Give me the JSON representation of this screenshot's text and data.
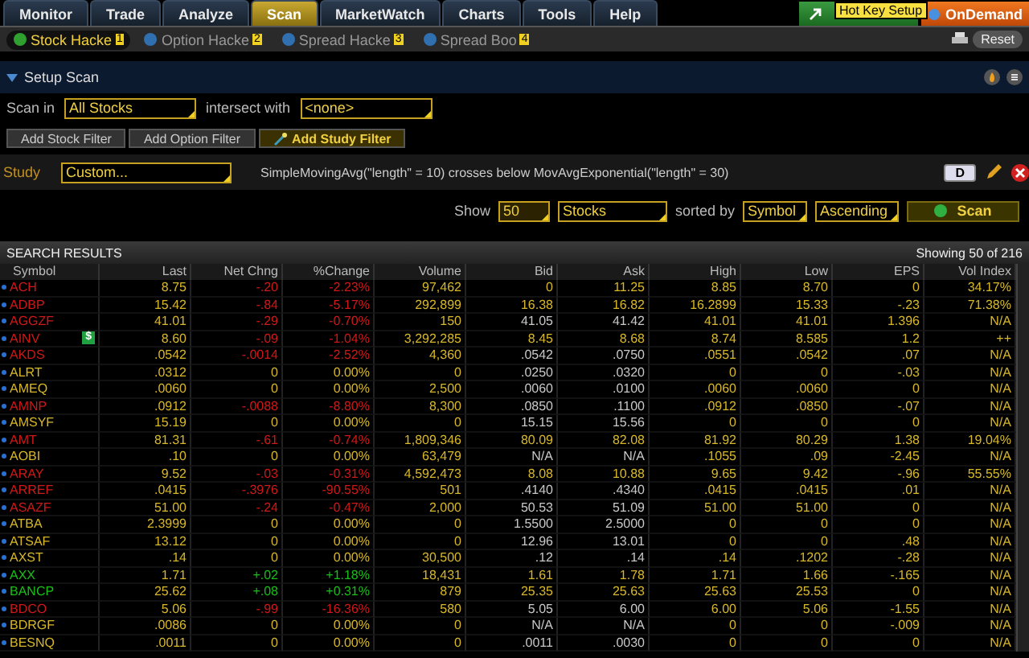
{
  "tabs": [
    {
      "label": "Monitor",
      "selected": false
    },
    {
      "label": "Trade",
      "selected": false
    },
    {
      "label": "Analyze",
      "selected": false
    },
    {
      "label": "Scan",
      "selected": true
    },
    {
      "label": "MarketWatch",
      "selected": false
    },
    {
      "label": "Charts",
      "selected": false
    },
    {
      "label": "Tools",
      "selected": false
    },
    {
      "label": "Help",
      "selected": false
    }
  ],
  "top_right": {
    "tooltip": "Hot Key Setup",
    "ondemand": "OnDemand"
  },
  "subtabs": [
    {
      "label": "Stock Hacke",
      "number": "1",
      "selected": true
    },
    {
      "label": "Option Hacke",
      "number": "2",
      "selected": false
    },
    {
      "label": "Spread Hacke",
      "number": "3",
      "selected": false
    },
    {
      "label": "Spread Boo",
      "number": "4",
      "selected": false
    }
  ],
  "reset_button": "Reset",
  "setup": {
    "title": "Setup Scan",
    "expanded": true,
    "scan_in_label": "Scan in",
    "scan_in": "All Stocks",
    "intersect_label": "intersect with",
    "intersect": "<none>"
  },
  "filter_buttons": [
    "Add Stock Filter",
    "Add Option Filter",
    "Add Study Filter"
  ],
  "study": {
    "label": "Study",
    "value": "Custom...",
    "formula": "SimpleMovingAvg(\"length\" = 10) crosses below MovAvgExponential(\"length\" = 30)",
    "button": "D"
  },
  "show_row": {
    "show_label": "Show",
    "count": "50",
    "type": "Stocks",
    "sorted_label": "sorted by",
    "sort_field": "Symbol",
    "order": "Ascending",
    "scan_button": "Scan"
  },
  "results": {
    "title": "SEARCH RESULTS",
    "showing": "Showing 50 of 216",
    "columns": [
      "Symbol",
      "Last",
      "Net Chng",
      "%Change",
      "Volume",
      "Bid",
      "Ask",
      "High",
      "Low",
      "EPS",
      "Vol Index"
    ],
    "rows": [
      {
        "symbol": "ACH",
        "last": "8.75",
        "net_chng": "-.20",
        "pct_change": "-2.23%",
        "volume": "97,462",
        "bid": "0",
        "ask": "11.25",
        "high": "8.85",
        "low": "8.70",
        "eps": "0",
        "vol_index": "34.17%",
        "color": "#d01818",
        "stale": false
      },
      {
        "symbol": "ADBP",
        "last": "15.42",
        "net_chng": "-.84",
        "pct_change": "-5.17%",
        "volume": "292,899",
        "bid": "16.38",
        "ask": "16.82",
        "high": "16.2899",
        "low": "15.33",
        "eps": "-.23",
        "vol_index": "71.38%",
        "color": "#d01818",
        "stale": false
      },
      {
        "symbol": "AGGZF",
        "last": "41.01",
        "net_chng": "-.29",
        "pct_change": "-0.70%",
        "volume": "150",
        "bid": "41.05",
        "ask": "41.42",
        "high": "41.01",
        "low": "41.01",
        "eps": "1.396",
        "vol_index": "N/A",
        "color": "#d01818",
        "stale": true
      },
      {
        "symbol": "AINV",
        "badge": "$",
        "last": "8.60",
        "net_chng": "-.09",
        "pct_change": "-1.04%",
        "volume": "3,292,285",
        "bid": "8.45",
        "ask": "8.68",
        "high": "8.74",
        "low": "8.585",
        "eps": "1.2",
        "vol_index": "++",
        "color": "#d01818",
        "stale": false
      },
      {
        "symbol": "AKDS",
        "last": ".0542",
        "net_chng": "-.0014",
        "pct_change": "-2.52%",
        "volume": "4,360",
        "bid": ".0542",
        "ask": ".0750",
        "high": ".0551",
        "low": ".0542",
        "eps": ".07",
        "vol_index": "N/A",
        "color": "#d01818",
        "stale": true
      },
      {
        "symbol": "ALRT",
        "last": ".0312",
        "net_chng": "0",
        "pct_change": "0.00%",
        "volume": "0",
        "bid": ".0250",
        "ask": ".0320",
        "high": "0",
        "low": "0",
        "eps": "-.03",
        "vol_index": "N/A",
        "color": "#d8b828",
        "stale": true
      },
      {
        "symbol": "AMEQ",
        "last": ".0060",
        "net_chng": "0",
        "pct_change": "0.00%",
        "volume": "2,500",
        "bid": ".0060",
        "ask": ".0100",
        "high": ".0060",
        "low": ".0060",
        "eps": "0",
        "vol_index": "N/A",
        "color": "#d8b828",
        "stale": true
      },
      {
        "symbol": "AMNP",
        "last": ".0912",
        "net_chng": "-.0088",
        "pct_change": "-8.80%",
        "volume": "8,300",
        "bid": ".0850",
        "ask": ".1100",
        "high": ".0912",
        "low": ".0850",
        "eps": "-.07",
        "vol_index": "N/A",
        "color": "#d01818",
        "stale": true
      },
      {
        "symbol": "AMSYF",
        "last": "15.19",
        "net_chng": "0",
        "pct_change": "0.00%",
        "volume": "0",
        "bid": "15.15",
        "ask": "15.56",
        "high": "0",
        "low": "0",
        "eps": "0",
        "vol_index": "N/A",
        "color": "#d8b828",
        "stale": true
      },
      {
        "symbol": "AMT",
        "last": "81.31",
        "net_chng": "-.61",
        "pct_change": "-0.74%",
        "volume": "1,809,346",
        "bid": "80.09",
        "ask": "82.08",
        "high": "81.92",
        "low": "80.29",
        "eps": "1.38",
        "vol_index": "19.04%",
        "color": "#d01818",
        "stale": false
      },
      {
        "symbol": "AOBI",
        "last": ".10",
        "net_chng": "0",
        "pct_change": "0.00%",
        "volume": "63,479",
        "bid": "N/A",
        "ask": "N/A",
        "high": ".1055",
        "low": ".09",
        "eps": "-2.45",
        "vol_index": "N/A",
        "color": "#d8b828",
        "stale": true
      },
      {
        "symbol": "ARAY",
        "last": "9.52",
        "net_chng": "-.03",
        "pct_change": "-0.31%",
        "volume": "4,592,473",
        "bid": "8.08",
        "ask": "10.88",
        "high": "9.65",
        "low": "9.42",
        "eps": "-.96",
        "vol_index": "55.55%",
        "color": "#d01818",
        "stale": false
      },
      {
        "symbol": "ARREF",
        "last": ".0415",
        "net_chng": "-.3976",
        "pct_change": "-90.55%",
        "volume": "501",
        "bid": ".4140",
        "ask": ".4340",
        "high": ".0415",
        "low": ".0415",
        "eps": ".01",
        "vol_index": "N/A",
        "color": "#d01818",
        "stale": true
      },
      {
        "symbol": "ASAZF",
        "last": "51.00",
        "net_chng": "-.24",
        "pct_change": "-0.47%",
        "volume": "2,000",
        "bid": "50.53",
        "ask": "51.09",
        "high": "51.00",
        "low": "51.00",
        "eps": "0",
        "vol_index": "N/A",
        "color": "#d01818",
        "stale": true
      },
      {
        "symbol": "ATBA",
        "last": "2.3999",
        "net_chng": "0",
        "pct_change": "0.00%",
        "volume": "0",
        "bid": "1.5500",
        "ask": "2.5000",
        "high": "0",
        "low": "0",
        "eps": "0",
        "vol_index": "N/A",
        "color": "#d8b828",
        "stale": true
      },
      {
        "symbol": "ATSAF",
        "last": "13.12",
        "net_chng": "0",
        "pct_change": "0.00%",
        "volume": "0",
        "bid": "12.96",
        "ask": "13.01",
        "high": "0",
        "low": "0",
        "eps": ".48",
        "vol_index": "N/A",
        "color": "#d8b828",
        "stale": true
      },
      {
        "symbol": "AXST",
        "last": ".14",
        "net_chng": "0",
        "pct_change": "0.00%",
        "volume": "30,500",
        "bid": ".12",
        "ask": ".14",
        "high": ".14",
        "low": ".1202",
        "eps": "-.28",
        "vol_index": "N/A",
        "color": "#d8b828",
        "stale": true
      },
      {
        "symbol": "AXX",
        "last": "1.71",
        "net_chng": "+.02",
        "pct_change": "+1.18%",
        "volume": "18,431",
        "bid": "1.61",
        "ask": "1.78",
        "high": "1.71",
        "low": "1.66",
        "eps": "-.165",
        "vol_index": "N/A",
        "color": "#18c018",
        "stale": false
      },
      {
        "symbol": "BANCP",
        "last": "25.62",
        "net_chng": "+.08",
        "pct_change": "+0.31%",
        "volume": "879",
        "bid": "25.35",
        "ask": "25.63",
        "high": "25.63",
        "low": "25.53",
        "eps": "0",
        "vol_index": "N/A",
        "color": "#18c018",
        "stale": false
      },
      {
        "symbol": "BDCO",
        "last": "5.06",
        "net_chng": "-.99",
        "pct_change": "-16.36%",
        "volume": "580",
        "bid": "5.05",
        "ask": "6.00",
        "high": "6.00",
        "low": "5.06",
        "eps": "-1.55",
        "vol_index": "N/A",
        "color": "#d01818",
        "stale": true
      },
      {
        "symbol": "BDRGF",
        "last": ".0086",
        "net_chng": "0",
        "pct_change": "0.00%",
        "volume": "0",
        "bid": "N/A",
        "ask": "N/A",
        "high": "0",
        "low": "0",
        "eps": "-.009",
        "vol_index": "N/A",
        "color": "#d8b828",
        "stale": true
      },
      {
        "symbol": "BESNQ",
        "last": ".0011",
        "net_chng": "0",
        "pct_change": "0.00%",
        "volume": "0",
        "bid": ".0011",
        "ask": ".0030",
        "high": "0",
        "low": "0",
        "eps": "0",
        "vol_index": "N/A",
        "color": "#d8b828",
        "stale": true
      }
    ]
  }
}
